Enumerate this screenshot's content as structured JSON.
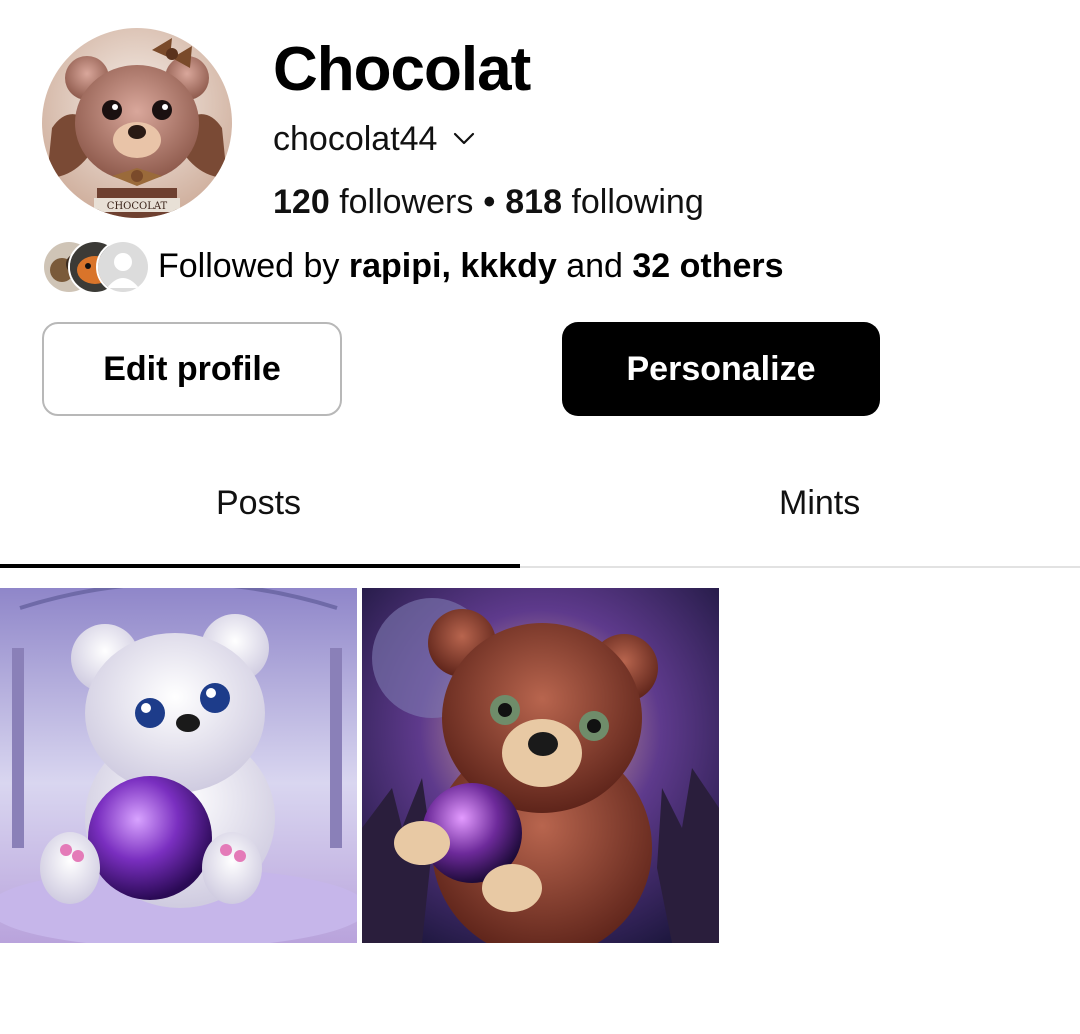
{
  "profile": {
    "display_name": "Chocolat",
    "username": "chocolat44",
    "followers_count": "120",
    "followers_label": "followers",
    "separator": "•",
    "following_count": "818",
    "following_label": "following",
    "avatar_label": "CHOCOLAT"
  },
  "followed_by": {
    "prefix": "Followed by",
    "names": "rapipi, kkkdy",
    "conjunction": "and",
    "others": "32 others"
  },
  "buttons": {
    "edit_profile": "Edit profile",
    "personalize": "Personalize"
  },
  "tabs": [
    {
      "label": "Posts",
      "active": true
    },
    {
      "label": "Mints",
      "active": false
    }
  ],
  "icons": {
    "username_dropdown": "chevron-down-icon"
  },
  "colors": {
    "primary_button_bg": "#000000",
    "secondary_button_border": "#b8b8b8",
    "tab_divider": "#e2e2e2"
  },
  "posts": [
    {
      "subject": "white bear with purple orb"
    },
    {
      "subject": "brown bear with galaxy orb"
    }
  ]
}
